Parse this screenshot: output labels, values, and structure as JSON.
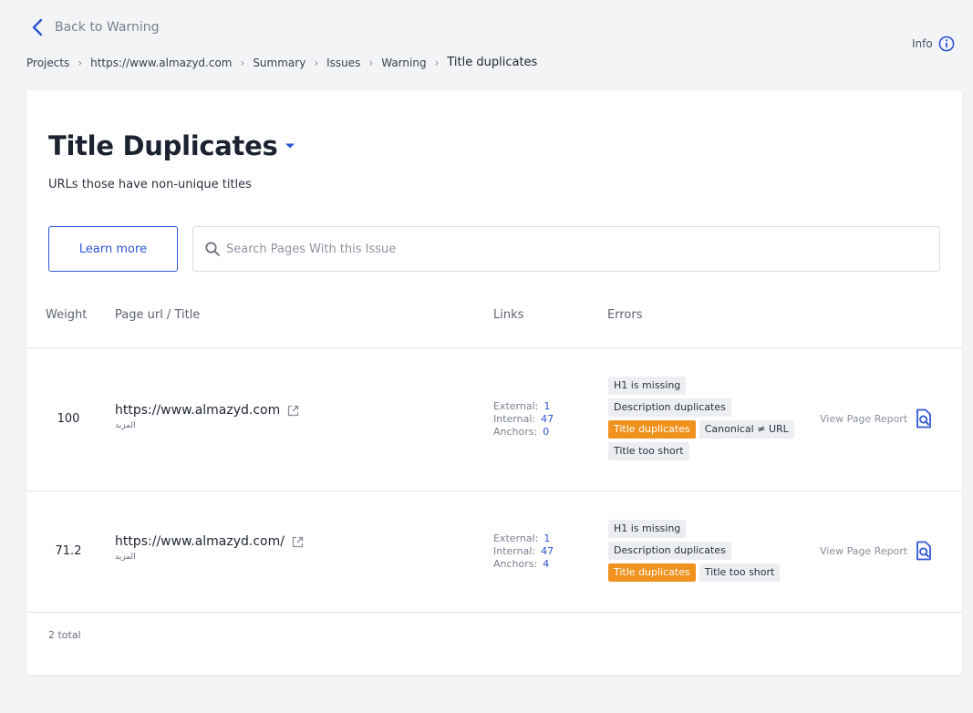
{
  "nav": {
    "back_label": "Back to Warning",
    "info_label": "Info"
  },
  "breadcrumb": [
    {
      "label": "Projects"
    },
    {
      "label": "https://www.almazyd.com"
    },
    {
      "label": "Summary"
    },
    {
      "label": "Issues"
    },
    {
      "label": "Warning"
    },
    {
      "label": "Title duplicates"
    }
  ],
  "issue": {
    "title": "Title Duplicates",
    "description": "URLs those have non-unique titles",
    "learn_more_label": "Learn more"
  },
  "search": {
    "placeholder": "Search Pages With this Issue",
    "value": ""
  },
  "table": {
    "columns": {
      "weight": "Weight",
      "page": "Page url / Title",
      "links": "Links",
      "errors": "Errors"
    },
    "link_labels": {
      "external": "External:",
      "internal": "Internal:",
      "anchors": "Anchors:"
    },
    "report_label": "View Page Report",
    "rows": [
      {
        "weight": "100",
        "url": "https://www.almazyd.com",
        "title": "المزيد",
        "external": "1",
        "internal": "47",
        "anchors": "0",
        "errors": [
          {
            "label": "H1 is missing",
            "highlight": false
          },
          {
            "label": "Description duplicates",
            "highlight": false
          },
          {
            "label": "Title duplicates",
            "highlight": true
          },
          {
            "label": "Canonical ≠ URL",
            "highlight": false
          },
          {
            "label": "Title too short",
            "highlight": false
          }
        ]
      },
      {
        "weight": "71.2",
        "url": "https://www.almazyd.com/",
        "title": "المزيد",
        "external": "1",
        "internal": "47",
        "anchors": "4",
        "errors": [
          {
            "label": "H1 is missing",
            "highlight": false
          },
          {
            "label": "Description duplicates",
            "highlight": false
          },
          {
            "label": "Title duplicates",
            "highlight": true
          },
          {
            "label": "Title too short",
            "highlight": false
          }
        ]
      }
    ],
    "total_label": "2 total"
  },
  "colors": {
    "accent": "#2f56d6",
    "highlight_tag": "#f0921e",
    "tag_bg": "#eceef1",
    "page_bg": "#f3f4f6"
  }
}
